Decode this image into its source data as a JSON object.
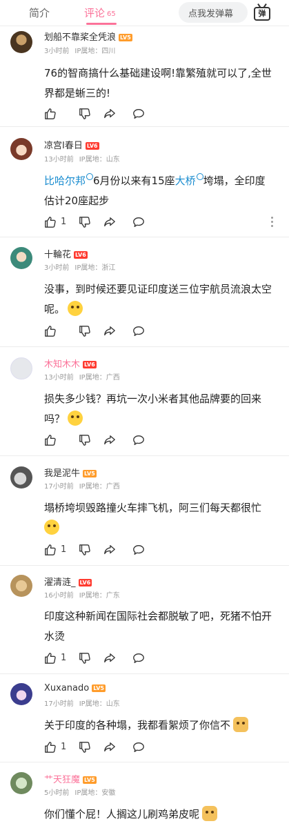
{
  "tabs": {
    "intro": "简介",
    "comments": "评论",
    "comments_count": "65"
  },
  "danmaku": {
    "placeholder": "点我发弹幕",
    "button": "弹"
  },
  "colors": {
    "accent": "#fb7299",
    "link": "#178bcf",
    "lv5": "#ff9c2b",
    "lv6": "#ff3b30"
  },
  "comments": [
    {
      "user": "划船不靠桨全凭浪",
      "level": "LV5",
      "time": "3小时前",
      "ip": "IP属地：四川",
      "text": "76的智商搞什么基础建设啊!靠繁殖就可以了,全世界都是蜥三的!",
      "likes": ""
    },
    {
      "user": "凉宫I春日",
      "level": "LV6",
      "time": "13小时前",
      "ip": "IP属地：山东",
      "link1": "比哈尔邦",
      "text_a": "6月份以来有15座",
      "link2": "大桥",
      "text_b": "垮塌，全印度估计20座起步",
      "likes": "1"
    },
    {
      "user": "十輪花",
      "level": "LV6",
      "time": "3小时前",
      "ip": "IP属地：浙江",
      "text": "没事，到时候还要见证印度送三位宇航员流浪太空呢。",
      "likes": ""
    },
    {
      "user": "木知木木",
      "level": "LV6",
      "time": "13小时前",
      "ip": "IP属地：广西",
      "text": "损失多少钱？再坑一次小米者其他品牌要的回来吗？",
      "likes": ""
    },
    {
      "user": "我是泥牛",
      "level": "LV5",
      "time": "17小时前",
      "ip": "IP属地：广西",
      "text": "塌桥垮坝毁路撞火车摔飞机，阿三们每天都很忙",
      "likes": "1"
    },
    {
      "user": "濯清涟_",
      "level": "LV6",
      "time": "16小时前",
      "ip": "IP属地：广东",
      "text": "印度这种新闻在国际社会都脱敏了吧，死猪不怕开水烫",
      "likes": "1"
    },
    {
      "user": "Xuxanado",
      "level": "LV5",
      "time": "17小时前",
      "ip": "IP属地：山东",
      "text": "关于印度的各种塌，我都看絮烦了你信不",
      "likes": "1"
    },
    {
      "user": "艹天狂魔",
      "level": "LV5",
      "time": "5小时前",
      "ip": "IP属地：安徽",
      "text": "你们懂个屁！人搁这儿刷鸡弟皮呢",
      "likes": ""
    }
  ]
}
